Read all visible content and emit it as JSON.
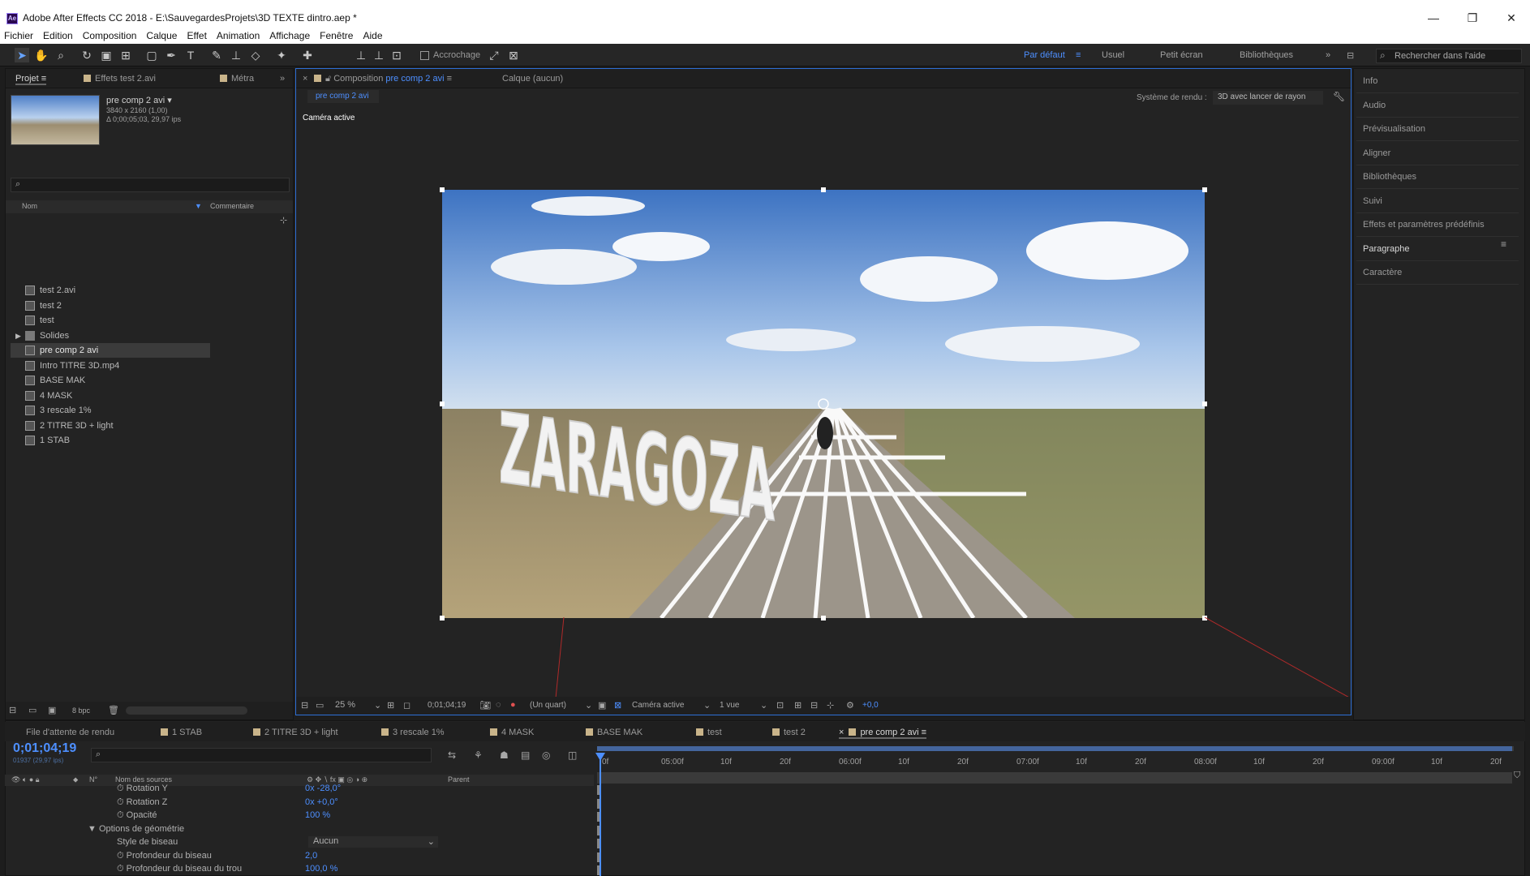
{
  "window": {
    "title": "Adobe After Effects CC 2018 - E:\\SauvegardesProjets\\3D TEXTE dintro.aep *",
    "logo": "Ae",
    "minimize": "—",
    "restore": "❐",
    "close": "✕"
  },
  "menu": [
    "Fichier",
    "Edition",
    "Composition",
    "Calque",
    "Effet",
    "Animation",
    "Affichage",
    "Fenêtre",
    "Aide"
  ],
  "toolbar": {
    "snap_label": "Accrochage",
    "workspaces": [
      "Par défaut",
      "Usuel",
      "Petit écran",
      "Bibliothèques"
    ],
    "active_workspace": "Par défaut",
    "search_placeholder": "Rechercher dans l'aide"
  },
  "project": {
    "tab": "Projet",
    "effects_tab": "Effets  test 2.avi",
    "meta_tab": "Métra",
    "item_name": "pre comp 2 avi ▾",
    "item_dims": "3840 x 2160 (1,00)",
    "item_dur": "Δ 0;00;05;03, 29,97 ips",
    "col_name": "Nom",
    "col_comment": "Commentaire",
    "bpc": "8 bpc",
    "items": [
      {
        "label": "test 2.avi"
      },
      {
        "label": "test 2"
      },
      {
        "label": "test"
      },
      {
        "label": "Solides"
      },
      {
        "label": "pre comp 2 avi"
      },
      {
        "label": "Intro TITRE 3D.mp4"
      },
      {
        "label": "BASE MAK"
      },
      {
        "label": "4 MASK"
      },
      {
        "label": "3 rescale 1%"
      },
      {
        "label": "2 TITRE 3D + light"
      },
      {
        "label": "1 STAB"
      }
    ],
    "selected": "pre comp 2 avi"
  },
  "composition": {
    "tab_prefix": "Composition",
    "tab_name": "pre comp 2 avi",
    "layer_tab": "Calque  (aucun)",
    "subtab": "pre comp 2 avi",
    "render_label": "Système de rendu :",
    "render_value": "3D avec lancer de rayon",
    "camera_label": "Caméra active",
    "viewer_text": "ZARAGOZA",
    "footer": {
      "zoom": "25 %",
      "time": "0;01;04;19",
      "resolution": "(Un quart)",
      "camera": "Caméra active",
      "views": "1 vue",
      "exposure": "+0,0"
    }
  },
  "right_panels": [
    "Info",
    "Audio",
    "Prévisualisation",
    "Aligner",
    "Bibliothèques",
    "Suivi",
    "Effets et paramètres prédéfinis",
    "Paragraphe",
    "Caractère"
  ],
  "timeline": {
    "tabs": [
      "File d'attente de rendu",
      "1 STAB",
      "2 TITRE 3D + light",
      "3 rescale 1%",
      "4 MASK",
      "BASE MAK",
      "test",
      "test 2",
      "pre comp 2 avi"
    ],
    "active_tab": "pre comp 2 avi",
    "timecode": "0;01;04;19",
    "frames": "01937 (29,97 ips)",
    "col_num": "N°",
    "col_source": "Nom des sources",
    "col_parent": "Parent",
    "ruler": [
      "0f",
      "05:00f",
      "10f",
      "20f",
      "06:00f",
      "10f",
      "20f",
      "07:00f",
      "10f",
      "20f",
      "08:00f",
      "10f",
      "20f",
      "09:00f",
      "10f",
      "20f"
    ],
    "props": [
      {
        "name": "Rotation Y",
        "value": "0x -28,0°"
      },
      {
        "name": "Rotation Z",
        "value": "0x +0,0°"
      },
      {
        "name": "Opacité",
        "value": "100 %"
      },
      {
        "name": "Options de géométrie",
        "value": ""
      },
      {
        "name": "Style de biseau",
        "value": "Aucun"
      },
      {
        "name": "Profondeur du biseau",
        "value": "2,0"
      },
      {
        "name": "Profondeur du biseau du trou",
        "value": "100,0 %"
      }
    ]
  }
}
